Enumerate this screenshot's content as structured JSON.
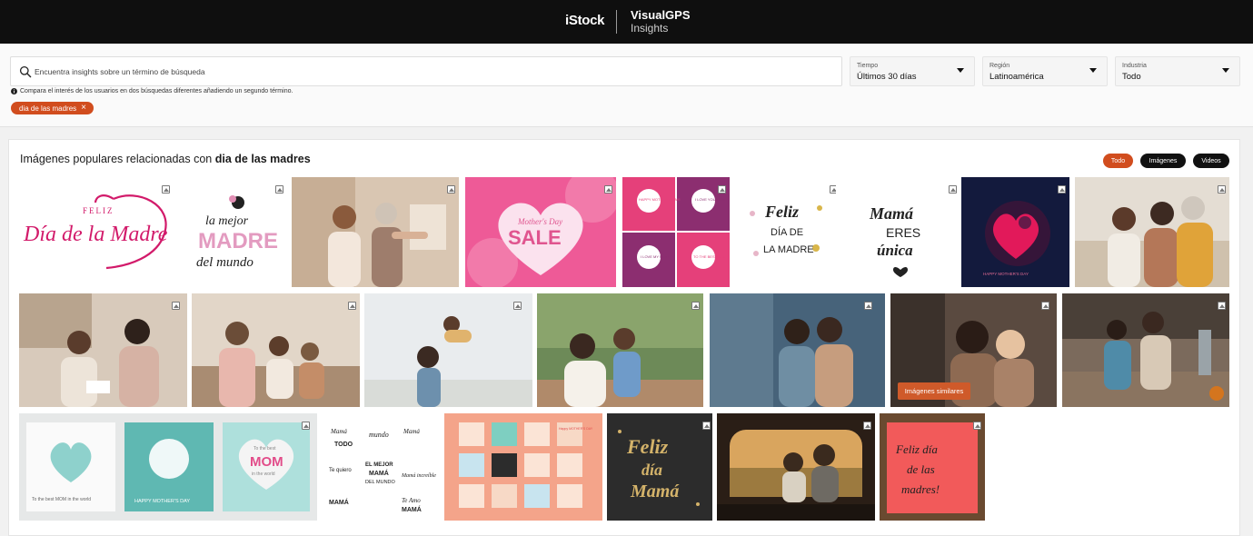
{
  "header": {
    "brand_istock": "iStock",
    "brand_visualgps": "VisualGPS",
    "brand_insights": "Insights"
  },
  "search": {
    "placeholder": "Encuentra insights sobre un término de búsqueda",
    "value": "",
    "hint": "Compara el interés de los usuarios en dos búsquedas diferentes añadiendo un segundo término.",
    "active_term": "dia de las madres"
  },
  "filters": [
    {
      "label": "Tiempo",
      "value": "Últimos 30 días"
    },
    {
      "label": "Región",
      "value": "Latinoamérica"
    },
    {
      "label": "Industria",
      "value": "Todo"
    }
  ],
  "panel": {
    "title_prefix": "Imágenes populares relacionadas con",
    "title_term": "dia de las madres",
    "tabs": [
      {
        "label": "Todo",
        "active": true
      },
      {
        "label": "Imágenes",
        "active": false
      },
      {
        "label": "Videos",
        "active": false
      }
    ],
    "similar_button": "Imágenes similares"
  },
  "tile_texts": {
    "t1_feliz": "FELIZ",
    "t1_main": "Día de la Madre",
    "t2_la": "la mejor",
    "t2_madre": "MADRE",
    "t2_mundo": "del mundo",
    "t4_small": "Mother's Day",
    "t4_sale": "SALE",
    "t5_a": "HAPPY MOTHER'S DAY!",
    "t5_b": "I LOVE YOU MOM",
    "t5_c": "I LOVE MY MOM",
    "t5_d": "TO THE BEST MOM",
    "t6_feliz": "Feliz",
    "t6_dia": "DÍA DE",
    "t6_madre": "LA MADRE",
    "t7_mama": "Mamá",
    "t7_eres": "ERES",
    "t7_unica": "única",
    "t8_caption": "HAPPY MOTHER'S DAY",
    "r3a_left": "To the best MOM in the world",
    "r3a_mid": "HAPPY MOTHER'S DAY",
    "r3a_right_1": "To the best",
    "r3a_right_2": "MOM",
    "r3a_right_3": "in the world",
    "r3b_1": "Mamá",
    "r3b_2": "TODO",
    "r3b_3": "mundo",
    "r3b_4": "EL MEJOR",
    "r3b_5": "MAMÁ",
    "r3b_6": "DEL MUNDO",
    "r3b_7": "Te quiero",
    "r3b_8": "Mamá increíble",
    "r3b_9": "Mamá",
    "r3b_10": "Te Amo",
    "r3b_11": "MAMÁ",
    "r3c_tag": "Happy MOTHER'S DAY",
    "r3d_feliz": "Feliz",
    "r3d_dia": "día",
    "r3d_mama": "Mamá",
    "r3f_1": "Feliz día",
    "r3f_2": "de las",
    "r3f_3": "madres!"
  },
  "colors": {
    "accent": "#d14d1e",
    "header_bg": "#0f0f0f",
    "pill_dark": "#111111"
  }
}
